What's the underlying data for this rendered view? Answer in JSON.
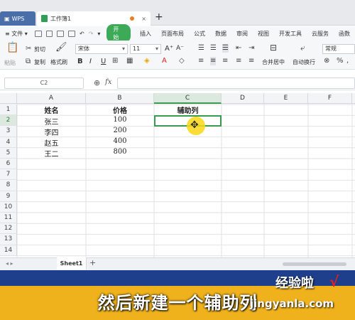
{
  "tabs": {
    "app": "WPS",
    "doc": "工作簿1",
    "close": "×",
    "add": "+"
  },
  "menu": {
    "file": "文件",
    "start": "开始",
    "items": [
      "插入",
      "页面布局",
      "公式",
      "数据",
      "审阅",
      "视图",
      "开发工具",
      "云服务",
      "函数"
    ]
  },
  "ribbon": {
    "paste": "粘贴",
    "cut": "剪切",
    "copy": "复制",
    "format_painter": "格式刷",
    "font": "宋体",
    "size": "11",
    "grow": "A⁺",
    "shrink": "A⁻",
    "bold": "B",
    "italic": "I",
    "underline": "U",
    "merge": "合并居中",
    "wrap": "自动换行",
    "number_format": "常规"
  },
  "formula_bar": {
    "cell_ref": "C2",
    "fx": "fx",
    "value": ""
  },
  "sheet": {
    "columns": [
      "A",
      "B",
      "C",
      "D",
      "E",
      "F"
    ],
    "rows": [
      "1",
      "2",
      "3",
      "4",
      "5",
      "6",
      "7",
      "8",
      "9",
      "10",
      "11",
      "12",
      "13",
      "14"
    ],
    "cells": {
      "A1": "姓名",
      "B1": "价格",
      "C1": "辅助列",
      "A2": "张三",
      "B2": "100",
      "A3": "李四",
      "B3": "200",
      "A4": "赵五",
      "B4": "400",
      "A5": "王二",
      "B5": "800"
    },
    "selected": "C2"
  },
  "sheet_tabs": {
    "active": "Sheet1",
    "add": "+"
  },
  "overlay": {
    "subtitle": "然后新建一个辅助列",
    "watermark_cn": "经验啦",
    "watermark_check": "√",
    "watermark_url": "jingyanla.com"
  },
  "colors": {
    "accent": "#3daa58",
    "selection": "#3a9a4f",
    "band_blue": "#1e3f8c",
    "band_yellow": "#f0b21c"
  }
}
